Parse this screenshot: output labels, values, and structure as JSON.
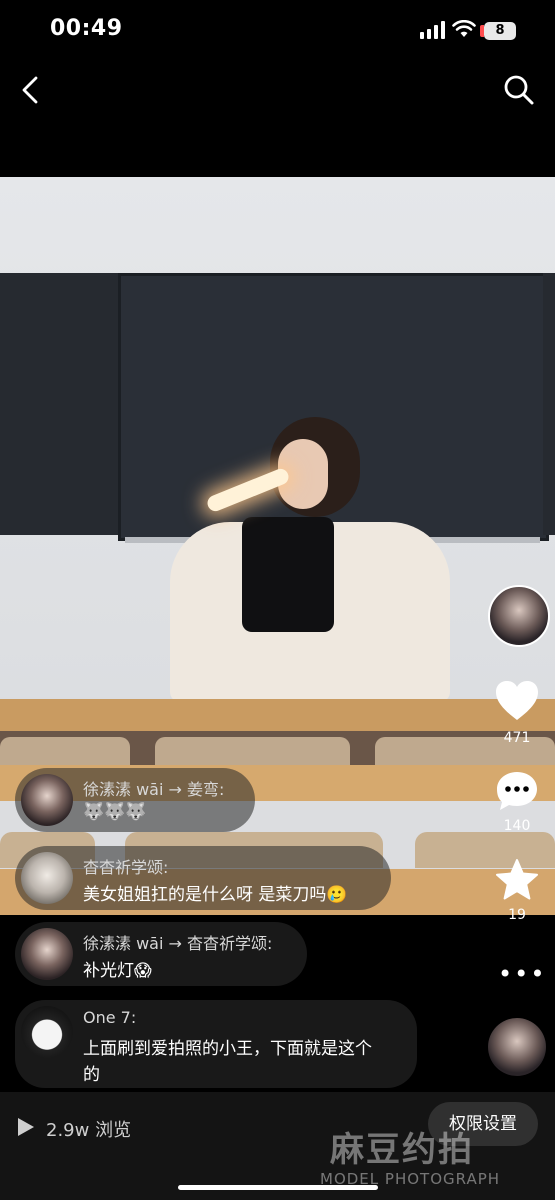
{
  "status_bar": {
    "time": "00:49",
    "battery": "8"
  },
  "topbar": {
    "back_icon": "chevron-left-icon",
    "search_icon": "search-icon"
  },
  "actions": {
    "likes": "471",
    "comments": "140",
    "favorites": "19"
  },
  "comments": [
    {
      "name": "徐溸溸 wāi → 姜弯:",
      "text": "🐺🐺🐺"
    },
    {
      "name": "杳杳祈学颂:",
      "text": "美女姐姐扛的是什么呀 是菜刀吗🥲"
    },
    {
      "name": "徐溸溸 wāi → 杳杳祈学颂:",
      "text": "补光灯😱"
    },
    {
      "name": "One 7:",
      "text": "上面刷到爱拍照的小王，下面就是这个",
      "text2": "的"
    }
  ],
  "bottom": {
    "views": "2.9w 浏览",
    "permission_label": "权限设置"
  },
  "watermark": {
    "main": "麻豆约拍",
    "sub": "MODEL PHOTOGRAPH"
  }
}
